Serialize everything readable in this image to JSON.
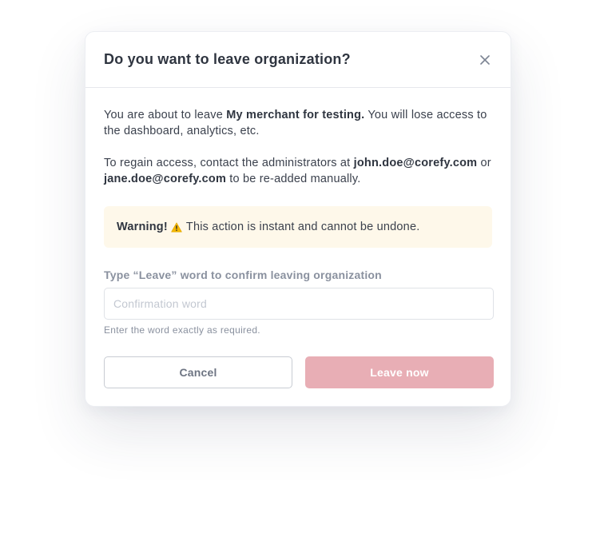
{
  "modal": {
    "title": "Do you want to leave organization?",
    "close_icon": "close-icon",
    "paragraph1": {
      "prefix": "You are about to leave ",
      "merchant": "My merchant for testing.",
      "suffix": " You will lose access to the dashboard, analytics, etc."
    },
    "paragraph2": {
      "prefix": "To regain access, contact the administrators at ",
      "email1": "john.doe@corefy.com",
      "middle": " or ",
      "email2": "jane.doe@corefy.com",
      "suffix": " to be re-added manually."
    },
    "warning": {
      "label": "Warning!",
      "icon": "warning-icon",
      "text": " This action is instant and cannot be undone."
    },
    "confirm": {
      "label": "Type “Leave” word to confirm leaving organization",
      "placeholder": "Confirmation word",
      "value": "",
      "hint": "Enter the word exactly as required."
    },
    "buttons": {
      "cancel": "Cancel",
      "leave": "Leave now"
    }
  },
  "colors": {
    "warning_bg": "#fef8ea",
    "leave_button_disabled": "#e8aeb5",
    "text": "#3b414d",
    "muted": "#8a919f"
  }
}
